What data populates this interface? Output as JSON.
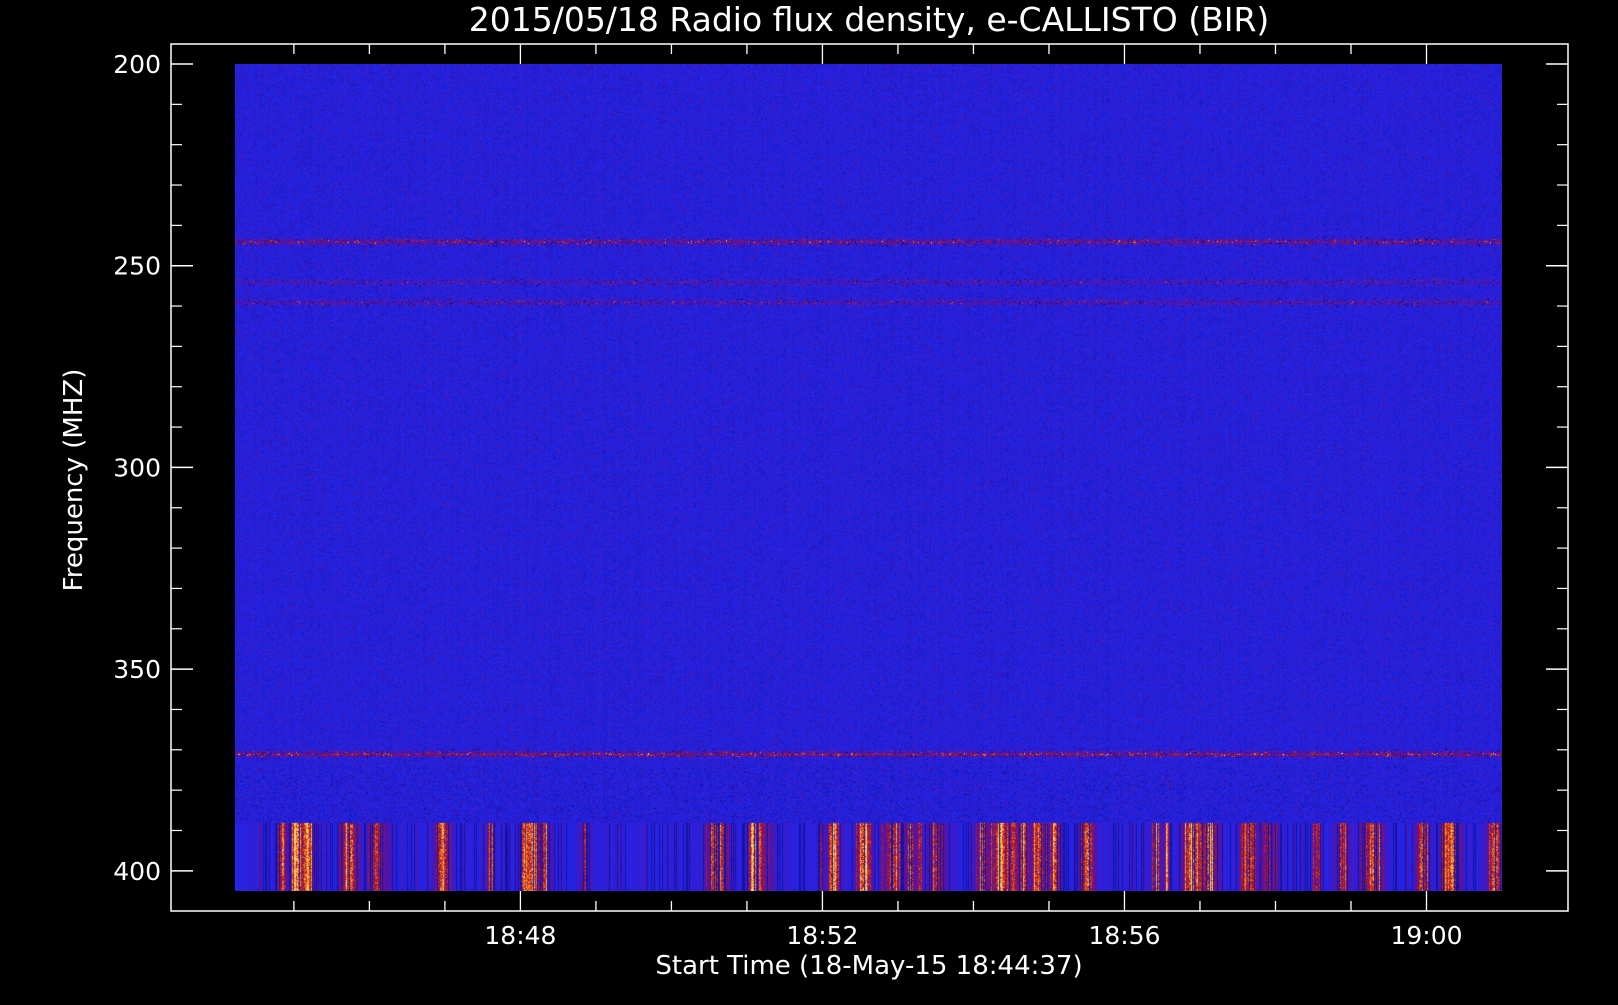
{
  "chart_data": {
    "type": "heatmap",
    "title": "2015/05/18  Radio flux density, e-CALLISTO (BIR)",
    "xlabel": "Start Time (18-May-15 18:44:37)",
    "ylabel": "Frequency (MHZ)",
    "x_start": "18:44:37",
    "x_end": "19:00:00",
    "xlim_minutes": [
      -0.78,
      16.0
    ],
    "x_tick_labels": [
      "18:48",
      "18:52",
      "18:56",
      "19:00"
    ],
    "x_tick_minutes": [
      3,
      7,
      11,
      15
    ],
    "ylim": [
      200,
      405
    ],
    "y_inverted": true,
    "y_tick_values": [
      200,
      250,
      300,
      350,
      400
    ],
    "y_tick_labels": [
      "200",
      "250",
      "300",
      "350",
      "400"
    ],
    "background_color": "#000000",
    "colormap": [
      "#0a0a80",
      "#2424e8",
      "#5a10a0",
      "#b01818",
      "#ff6a10",
      "#ffe070"
    ],
    "features": [
      {
        "kind": "horizontal-band",
        "freq_mhz": 244,
        "intensity": 0.55
      },
      {
        "kind": "horizontal-band",
        "freq_mhz": 254,
        "intensity": 0.3
      },
      {
        "kind": "horizontal-band",
        "freq_mhz": 259,
        "intensity": 0.35
      },
      {
        "kind": "horizontal-band",
        "freq_mhz": 371,
        "intensity": 0.6
      },
      {
        "kind": "burst-region",
        "freq_range_mhz": [
          388,
          405
        ],
        "intensity": 0.85
      }
    ]
  }
}
